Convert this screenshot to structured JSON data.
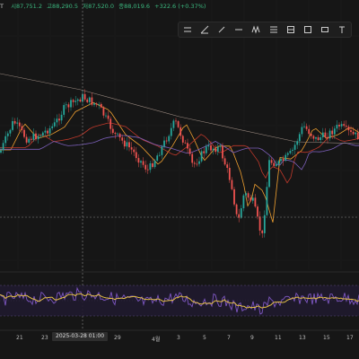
{
  "ohlc": {
    "symbol": "T",
    "open": "시87,751.2",
    "high": "고88,290.5",
    "low": "저87,520.0",
    "close": "종88,019.6",
    "change": "+322.6 (+0.37%)"
  },
  "toolbar": {
    "tools": [
      "hline-icon",
      "trendline-icon",
      "pen-icon",
      "horizontal-ray-icon",
      "zigzag-icon",
      "fib-icon",
      "pattern-icon",
      "long-position-icon",
      "rectangle-icon",
      "text-icon"
    ]
  },
  "x_axis": {
    "labels": [
      "21",
      "23",
      "25",
      "27",
      "29",
      "4월",
      "3",
      "5",
      "7",
      "9",
      "11",
      "13",
      "15",
      "17"
    ],
    "crosshair_label": "2025-03-28  01:00"
  },
  "colors": {
    "up": "#26a69a",
    "down": "#ef5350",
    "background": "#161616",
    "ma_orange": "#f0a030",
    "ma_red": "#c0392b",
    "ma_purple": "#7b5fb8",
    "rsi_line": "#7e57c2",
    "rsi_ma": "#e6c045"
  }
}
